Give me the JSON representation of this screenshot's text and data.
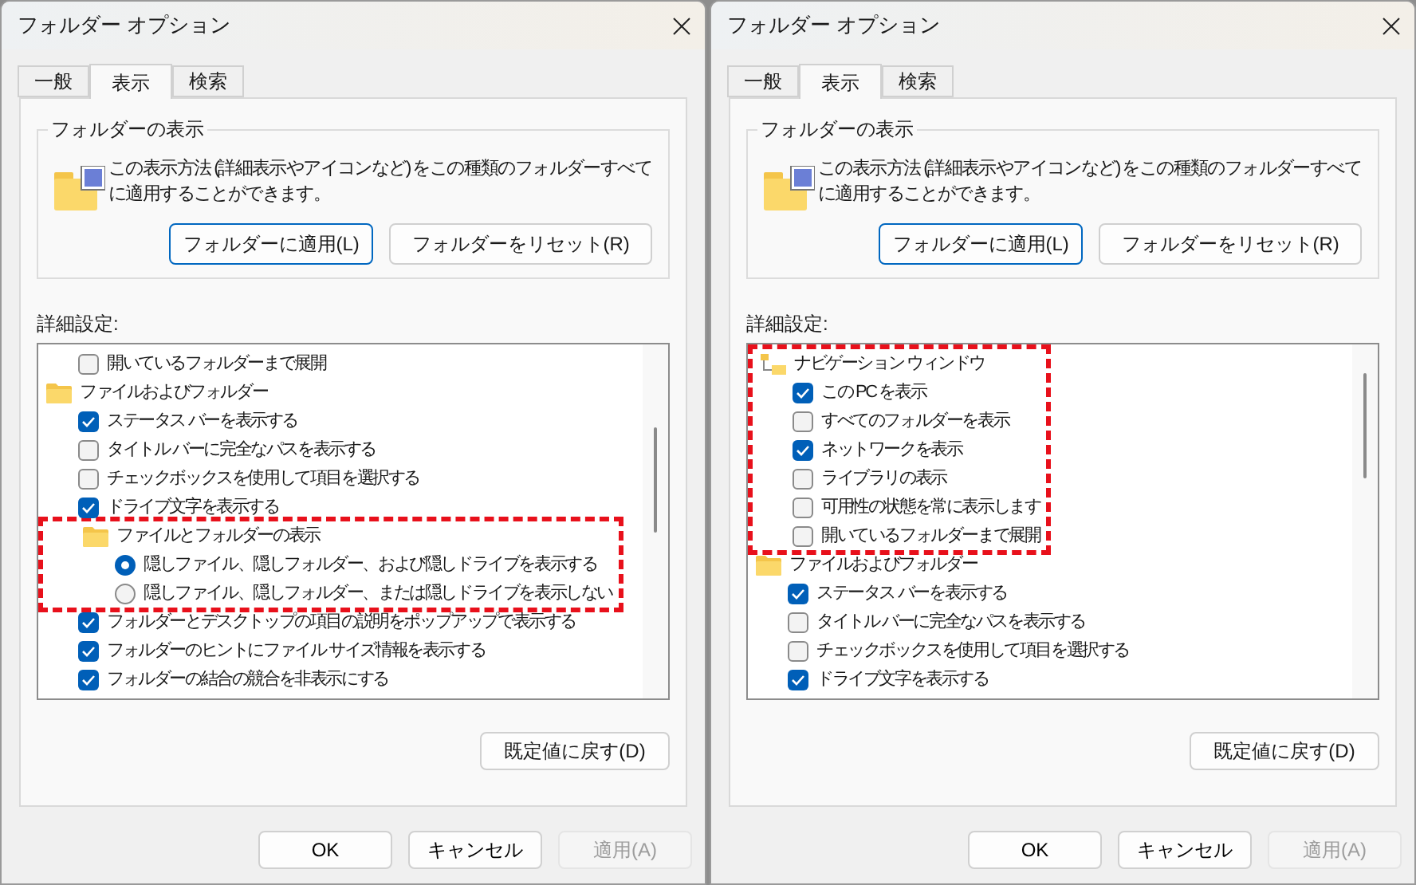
{
  "windows": [
    {
      "title": "フォルダー オプション",
      "tabs": [
        {
          "label": "一般",
          "selected": false
        },
        {
          "label": "表示",
          "selected": true
        },
        {
          "label": "検索",
          "selected": false
        }
      ],
      "view_group": {
        "title": "フォルダーの表示",
        "description": "この表示方法 (詳細表示やアイコンなど) をこの種類のフォルダーすべてに適用することができます。",
        "buttons": [
          {
            "label": "フォルダーに適用(L)",
            "focused": true
          },
          {
            "label": "フォルダーをリセット(R)",
            "focused": false
          }
        ]
      },
      "advanced_label": "詳細設定:",
      "settings": [
        {
          "kind": "checkbox",
          "label": "開いているフォルダーまで展開",
          "checked": false
        },
        {
          "kind": "folder",
          "label": "ファイルおよびフォルダー",
          "highlighted": false,
          "children": [
            {
              "kind": "checkbox",
              "label": "ステータス バーを表示する",
              "checked": true
            },
            {
              "kind": "checkbox",
              "label": "タイトル バーに完全なパスを表示する",
              "checked": false
            },
            {
              "kind": "checkbox",
              "label": "チェックボックスを使用して項目を選択する",
              "checked": false
            },
            {
              "kind": "checkbox",
              "label": "ドライブ文字を表示する",
              "checked": true
            },
            {
              "kind": "folder",
              "label": "ファイルとフォルダーの表示",
              "highlighted": true,
              "children": [
                {
                  "kind": "radio",
                  "label": "隠しファイル、隠しフォルダー、および隠しドライブを表示する",
                  "selected": true
                },
                {
                  "kind": "radio",
                  "label": "隠しファイル、隠しフォルダー、または隠しドライブを表示しない",
                  "selected": false
                }
              ]
            },
            {
              "kind": "checkbox",
              "label": "フォルダーとデスクトップの項目の説明をポップアップで表示する",
              "checked": true
            },
            {
              "kind": "checkbox",
              "label": "フォルダーのヒントにファイル サイズ情報を表示する",
              "checked": true
            },
            {
              "kind": "checkbox",
              "label": "フォルダーの結合の競合を非表示にする",
              "checked": true
            }
          ]
        }
      ],
      "restore_button": "既定値に戻す(D)",
      "buttons": [
        {
          "label": "OK",
          "disabled": false
        },
        {
          "label": "キャンセル",
          "disabled": false
        },
        {
          "label": "適用(A)",
          "disabled": true
        }
      ]
    },
    {
      "title": "フォルダー オプション",
      "tabs": [
        {
          "label": "一般",
          "selected": false
        },
        {
          "label": "表示",
          "selected": true
        },
        {
          "label": "検索",
          "selected": false
        }
      ],
      "view_group": {
        "title": "フォルダーの表示",
        "description": "この表示方法 (詳細表示やアイコンなど) をこの種類のフォルダーすべてに適用することができます。",
        "buttons": [
          {
            "label": "フォルダーに適用(L)",
            "focused": true
          },
          {
            "label": "フォルダーをリセット(R)",
            "focused": false
          }
        ]
      },
      "advanced_label": "詳細設定:",
      "settings": [
        {
          "kind": "pane",
          "label": "ナビゲーション ウィンドウ",
          "highlighted": true,
          "children": [
            {
              "kind": "checkbox",
              "label": "この PC を表示",
              "checked": true
            },
            {
              "kind": "checkbox",
              "label": "すべてのフォルダーを表示",
              "checked": false
            },
            {
              "kind": "checkbox",
              "label": "ネットワークを表示",
              "checked": true
            },
            {
              "kind": "checkbox",
              "label": "ライブラリの表示",
              "checked": false
            },
            {
              "kind": "checkbox",
              "label": "可用性の状態を常に表示します",
              "checked": false
            },
            {
              "kind": "checkbox",
              "label": "開いているフォルダーまで展開",
              "checked": false
            }
          ]
        },
        {
          "kind": "folder",
          "label": "ファイルおよびフォルダー",
          "highlighted": false,
          "children": [
            {
              "kind": "checkbox",
              "label": "ステータス バーを表示する",
              "checked": true
            },
            {
              "kind": "checkbox",
              "label": "タイトル バーに完全なパスを表示する",
              "checked": false
            },
            {
              "kind": "checkbox",
              "label": "チェックボックスを使用して項目を選択する",
              "checked": false
            },
            {
              "kind": "checkbox",
              "label": "ドライブ文字を表示する",
              "checked": true
            }
          ]
        }
      ],
      "restore_button": "既定値に戻す(D)",
      "buttons": [
        {
          "label": "OK",
          "disabled": false
        },
        {
          "label": "キャンセル",
          "disabled": false
        },
        {
          "label": "適用(A)",
          "disabled": true
        }
      ]
    }
  ]
}
